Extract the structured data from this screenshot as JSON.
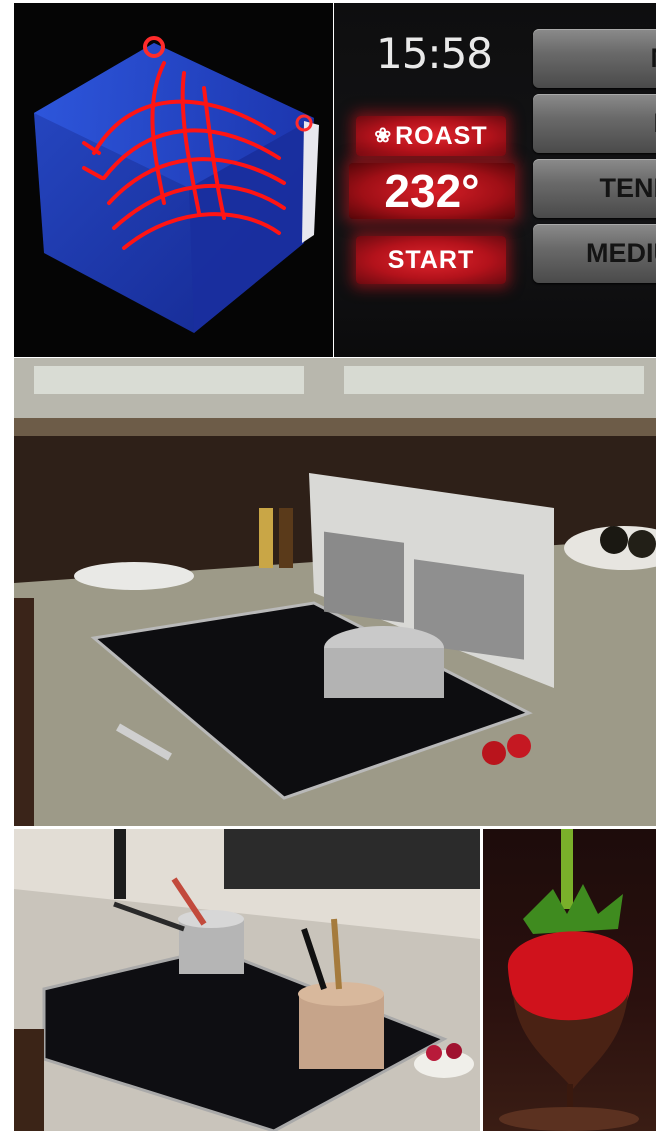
{
  "control_panel": {
    "clock": "15:58",
    "mode_label": "ROAST",
    "mode_icon": "fan-icon",
    "temperature": "232°",
    "start_label": "START",
    "menu_items": [
      "M",
      "B",
      "TEND",
      "MEDIU"
    ]
  },
  "colors": {
    "control_red": "#c8161f",
    "menu_gray": "#6a6a6a",
    "cube_blue": "#1f3ec0",
    "airflow_red": "#ff1010"
  }
}
